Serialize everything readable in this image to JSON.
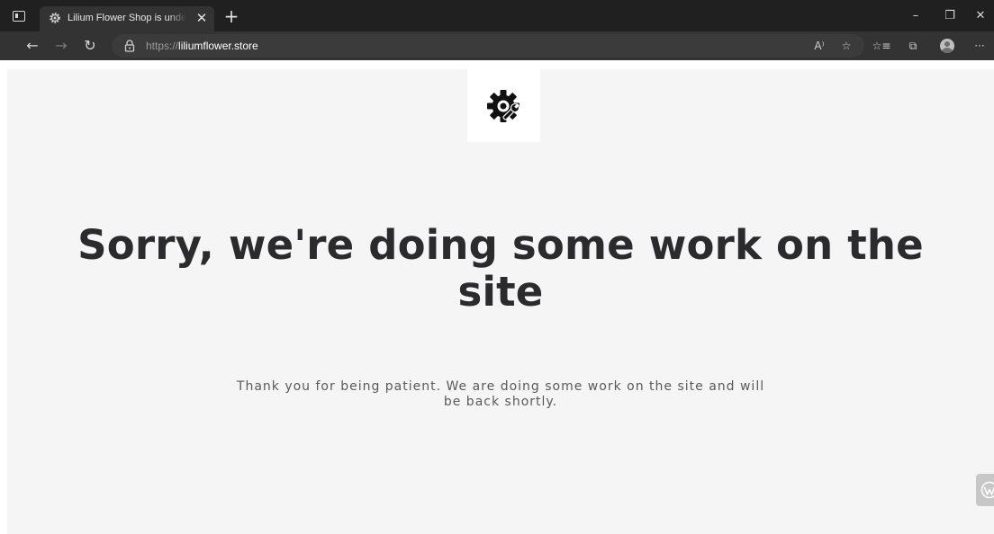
{
  "browser": {
    "tab": {
      "title": "Lilium Flower Shop is under construction",
      "close_glyph": "✕",
      "favicon": "gear-wrench-icon"
    },
    "new_tab_glyph": "+",
    "window_controls": {
      "minimize": "–",
      "restore": "❐",
      "close": "✕"
    },
    "nav": {
      "back": "←",
      "forward": "→",
      "refresh": "↻"
    },
    "address": {
      "scheme": "https://",
      "host": "liliumflower.store"
    },
    "toolbar_icons": {
      "read_aloud": "A⁾",
      "add_favorite": "☆",
      "favorites": "☆≡",
      "collections": "⧉",
      "menu": "···"
    }
  },
  "page": {
    "headline": "Sorry, we're doing some work on the site",
    "subtext": "Thank you for being patient. We are doing some work on the site and will be back shortly."
  },
  "colors": {
    "tabstrip_bg": "#202020",
    "toolbar_bg": "#333333",
    "page_bg": "#f5f5f5",
    "headline": "#2b2b2e",
    "subtext": "#5a5a5a"
  }
}
